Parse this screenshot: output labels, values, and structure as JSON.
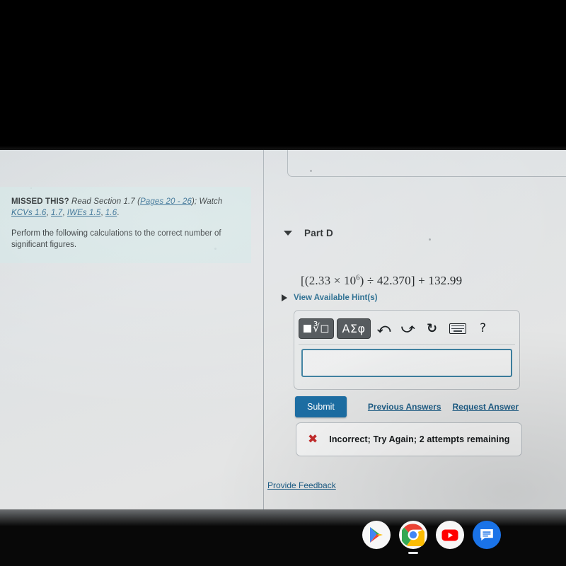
{
  "left_panel": {
    "hint": {
      "missed_label": "MISSED THIS?",
      "read_text": "Read Section 1.7",
      "pages_link": "Pages 20 - 26",
      "watch_text": "; Watch",
      "links": [
        {
          "label": "KCVs 1.6"
        },
        {
          "label": "1.7"
        },
        {
          "label": "IWEs 1.5"
        },
        {
          "label": "1.6"
        }
      ],
      "trailing_punct": ".",
      "instruction": "Perform the following calculations to the correct number of significant figures."
    }
  },
  "right_panel": {
    "part": {
      "collapse_icon": "triangle-down-icon",
      "label": "Part D"
    },
    "formula": {
      "text": "[(2.33 × 10⁶) ÷ 42.370] + 132.99",
      "lead": "[(2.33 × 10",
      "exponent": "6",
      "tail": ") ÷ 42.370] + 132.99"
    },
    "hints": {
      "expand_icon": "triangle-right-icon",
      "label": "View Available Hint(s)"
    },
    "math_toolbar": {
      "buttons": [
        {
          "name": "math-template-button",
          "icon": "square-nth-root-icon",
          "nroot_glyph": "∛"
        },
        {
          "name": "greek-symbols-button",
          "label": "ΑΣφ"
        },
        {
          "name": "undo-button",
          "glyph": "↰",
          "icon": "undo-arrow-icon"
        },
        {
          "name": "redo-button",
          "glyph": "↱",
          "icon": "redo-arrow-icon"
        },
        {
          "name": "reset-button",
          "glyph": "↻",
          "icon": "reset-circular-arrow-icon"
        },
        {
          "name": "keyboard-button",
          "icon": "keyboard-icon"
        },
        {
          "name": "help-button",
          "glyph": "?",
          "icon": "question-mark-icon"
        }
      ]
    },
    "answer_input": {
      "value": "",
      "placeholder": ""
    },
    "actions": {
      "submit_label": "Submit",
      "previous_answers_label": "Previous Answers",
      "request_answer_label": "Request Answer"
    },
    "feedback": {
      "icon": "red-x-icon",
      "glyph": "✖",
      "message": "Incorrect; Try Again; 2 attempts remaining"
    },
    "provide_feedback_label": "Provide Feedback"
  },
  "shelf": {
    "apps": [
      {
        "name": "play-store-icon",
        "label": "Play Store",
        "active": false
      },
      {
        "name": "chrome-icon",
        "label": "Chrome",
        "active": true
      },
      {
        "name": "youtube-icon",
        "label": "YouTube",
        "active": false
      },
      {
        "name": "messages-icon",
        "label": "Messages",
        "active": false
      }
    ]
  },
  "colors": {
    "accent_link": "#1d5d86",
    "submit_blue": "#1c6ea4",
    "input_border": "#3c7f9f",
    "error_red": "#c32b2b",
    "hint_bg": "#d1e5e4"
  }
}
